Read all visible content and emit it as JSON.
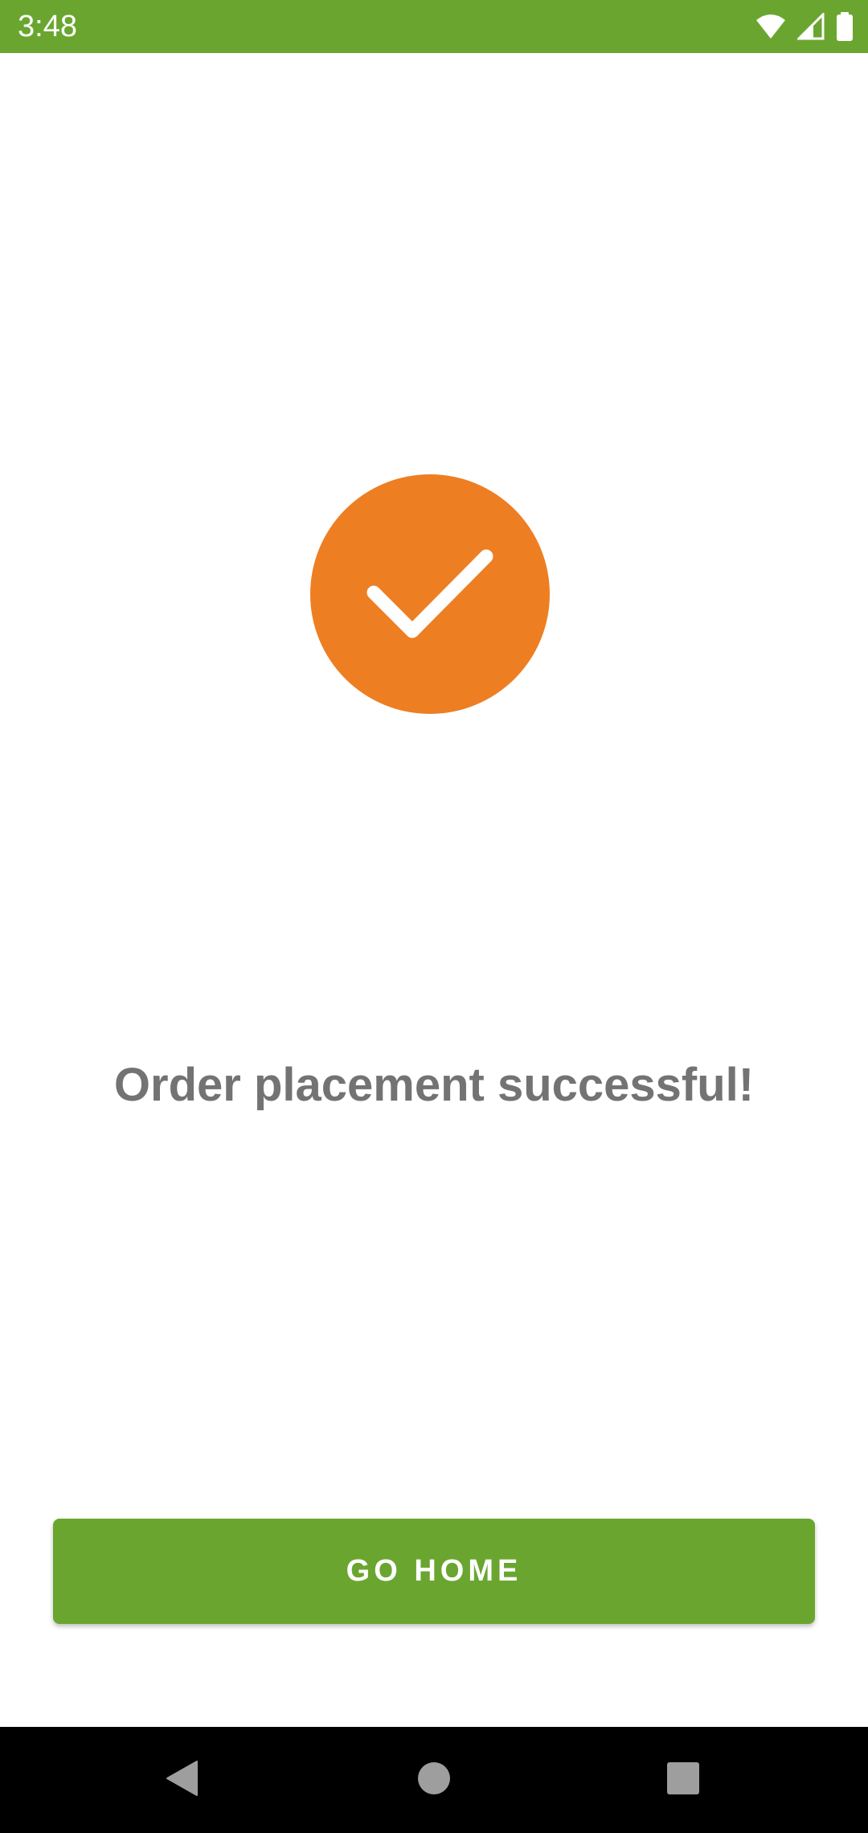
{
  "status_bar": {
    "time": "3:48",
    "background": "#6aa62f",
    "icons": [
      "wifi-icon",
      "signal-icon",
      "battery-icon"
    ]
  },
  "success": {
    "icon": "check-icon",
    "circle_color": "#ee7e22",
    "message": "Order placement successful!"
  },
  "actions": {
    "go_home_label": "GO HOME",
    "button_color": "#6aa62f"
  },
  "nav_bar": {
    "icons": [
      "back-icon",
      "home-icon",
      "recents-icon"
    ]
  }
}
